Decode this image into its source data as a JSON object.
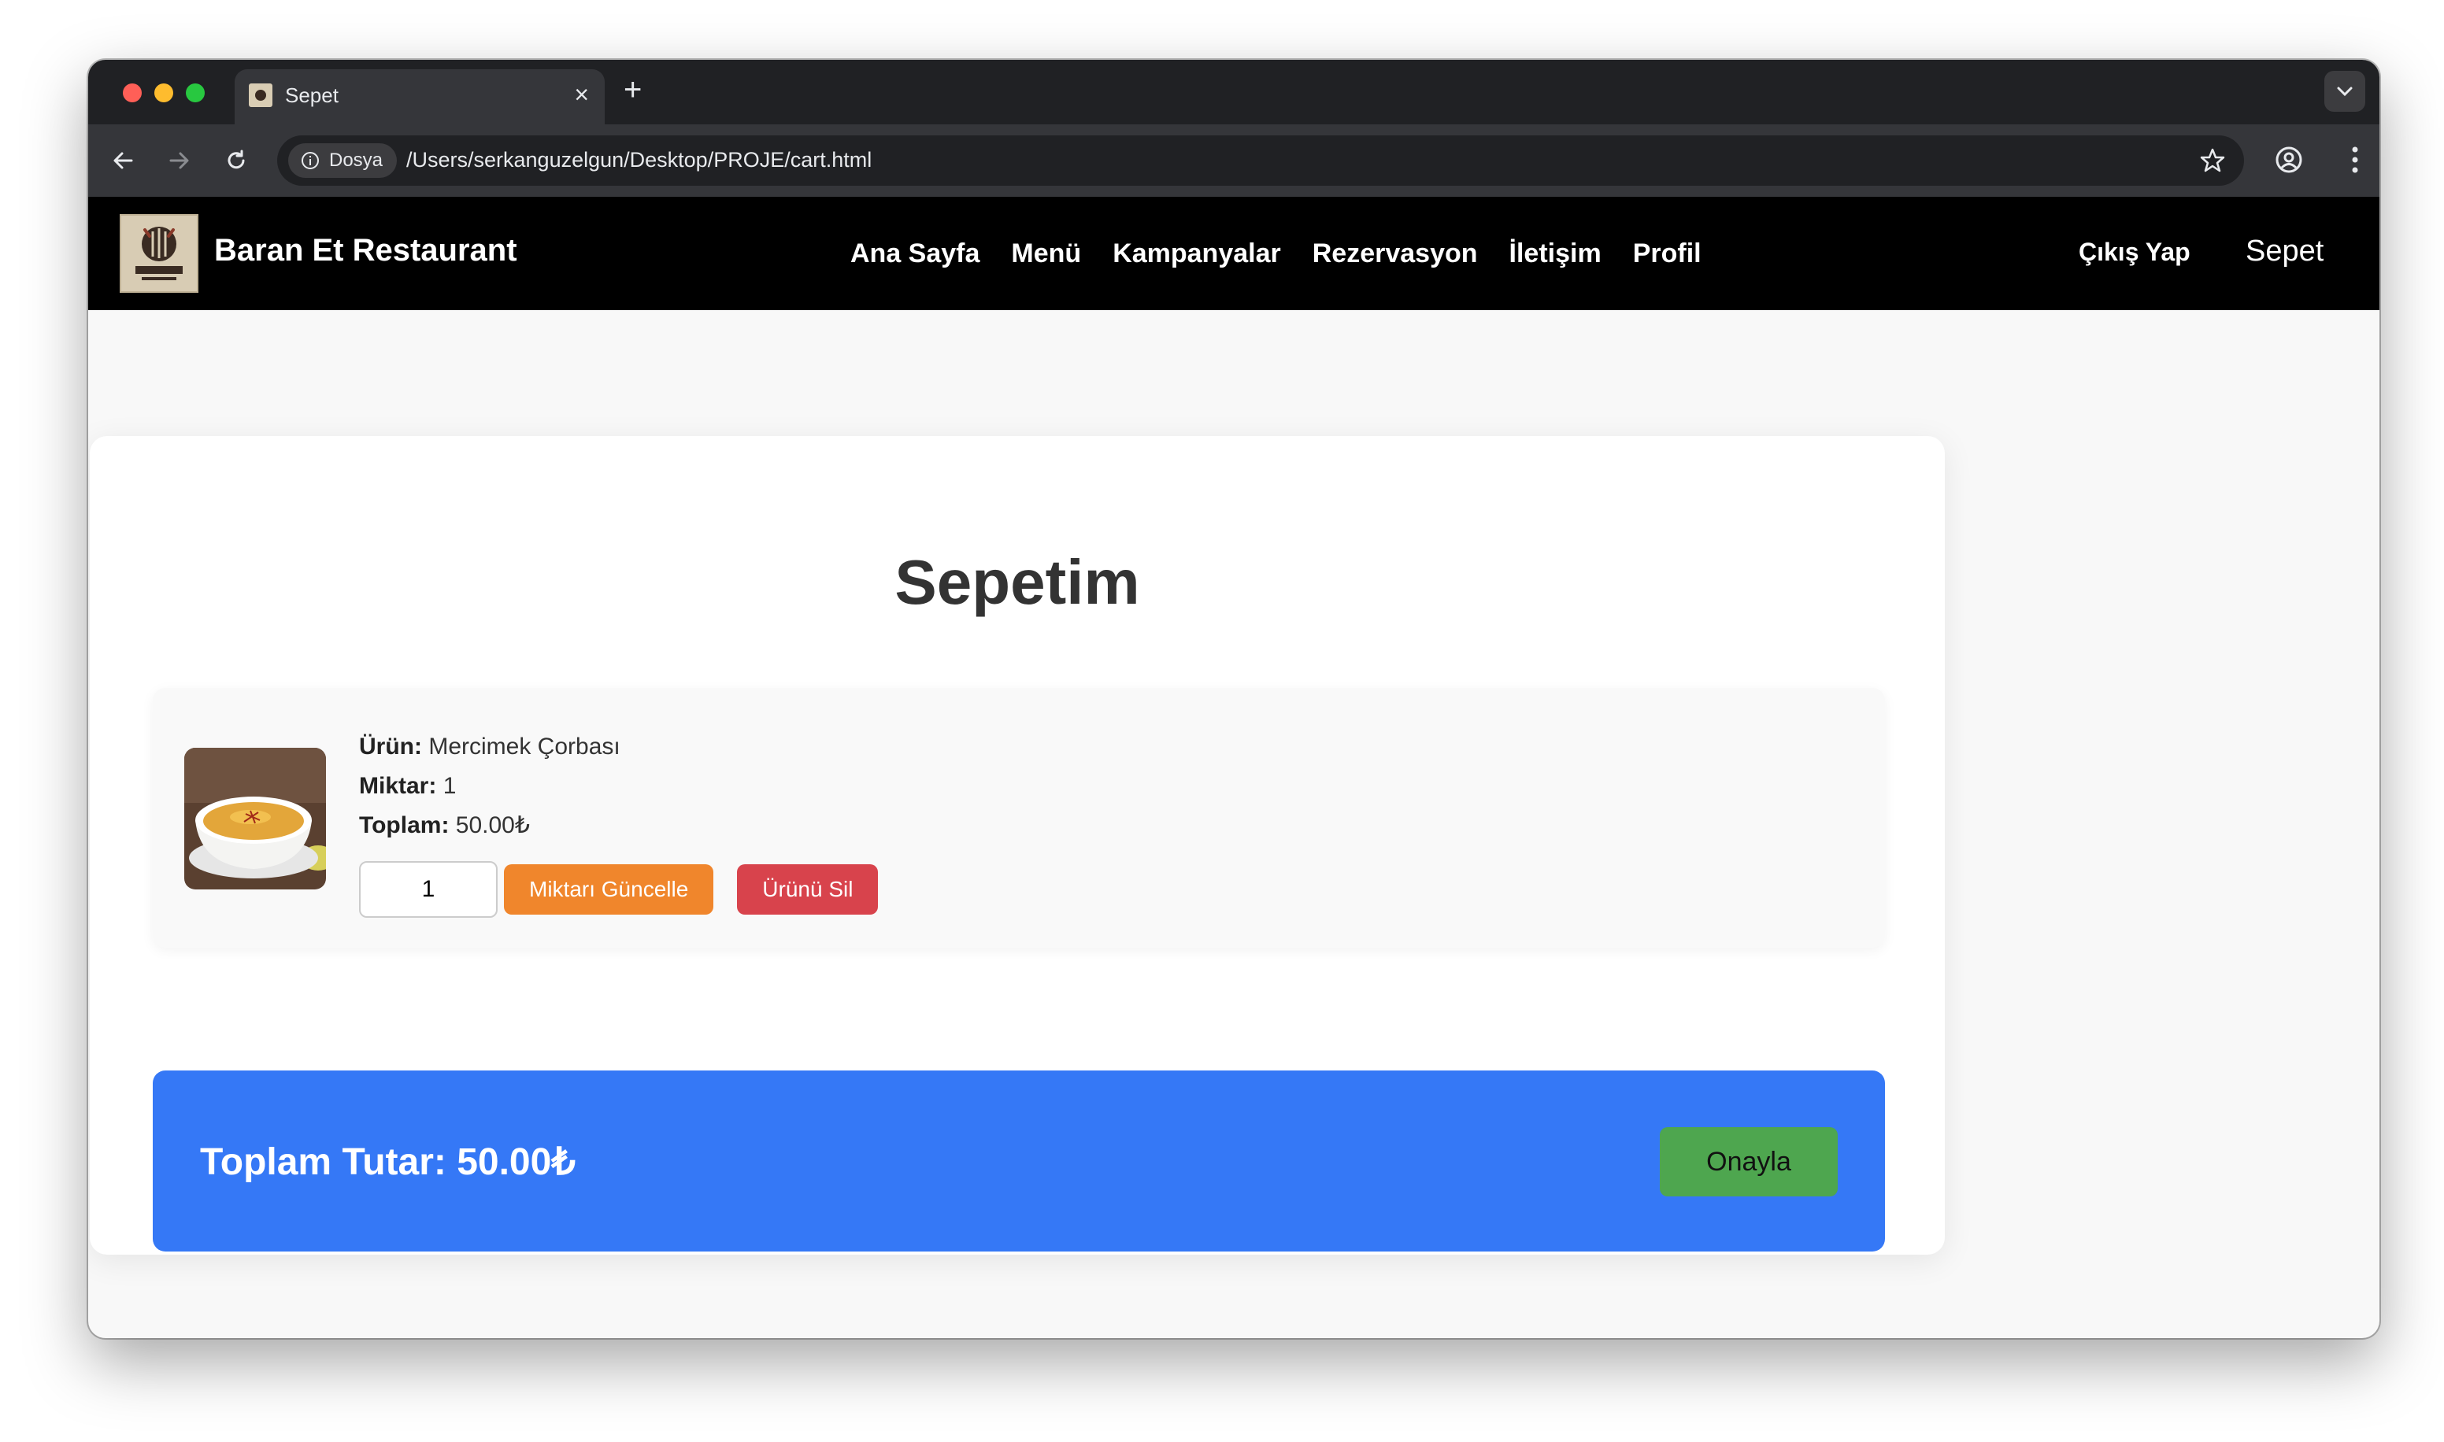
{
  "browser": {
    "tab_title": "Sepet",
    "tab_close": "×",
    "new_tab": "+",
    "site_chip": "Dosya",
    "url": "/Users/serkanguzelgun/Desktop/PROJE/cart.html"
  },
  "site": {
    "brand": "Baran Et Restaurant",
    "nav": [
      "Ana Sayfa",
      "Menü",
      "Kampanyalar",
      "Rezervasyon",
      "İletişim",
      "Profil"
    ],
    "logout": "Çıkış Yap",
    "cart": "Sepet"
  },
  "cart": {
    "title": "Sepetim",
    "item": {
      "product_label": "Ürün:",
      "product_name": "Mercimek Çorbası",
      "qty_label": "Miktar:",
      "qty": "1",
      "total_label": "Toplam:",
      "total": "50.00₺",
      "input_value": "1",
      "update_button": "Miktarı Güncelle",
      "delete_button": "Ürünü Sil"
    },
    "grand_total": "Toplam Tutar: 50.00₺",
    "confirm_button": "Onayla"
  },
  "colors": {
    "nav_bg": "#000000",
    "total_bar": "#3578f6",
    "update_button": "#f0862c",
    "delete_button": "#d8434c",
    "confirm_button": "#4ea64f"
  }
}
